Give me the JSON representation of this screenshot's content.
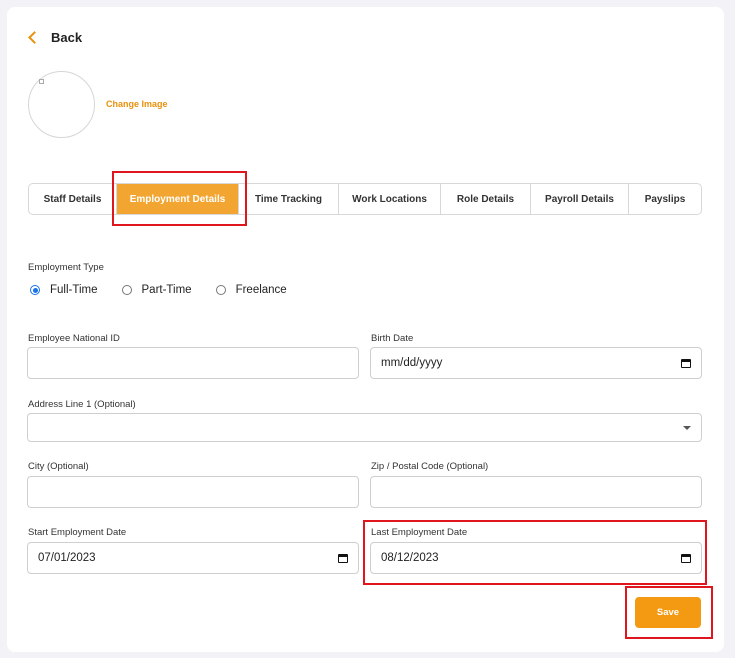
{
  "back_label": "Back",
  "change_image_label": "Change Image",
  "tabs": [
    {
      "label": "Staff Details"
    },
    {
      "label": "Employment Details"
    },
    {
      "label": "Time Tracking"
    },
    {
      "label": "Work Locations"
    },
    {
      "label": "Role Details"
    },
    {
      "label": "Payroll Details"
    },
    {
      "label": "Payslips"
    }
  ],
  "active_tab": "Employment Details",
  "employment_type": {
    "label": "Employment Type",
    "options": [
      "Full-Time",
      "Part-Time",
      "Freelance"
    ],
    "selected": "Full-Time"
  },
  "fields": {
    "national_id": {
      "label": "Employee National ID",
      "value": ""
    },
    "birth_date": {
      "label": "Birth Date",
      "value": "mm/dd/yyyy"
    },
    "address": {
      "label": "Address Line 1 (Optional)",
      "value": ""
    },
    "city": {
      "label": "City (Optional)",
      "value": ""
    },
    "zip": {
      "label": "Zip / Postal Code (Optional)",
      "value": ""
    },
    "start_date": {
      "label": "Start Employment Date",
      "value": "07/01/2023"
    },
    "last_date": {
      "label": "Last Employment Date",
      "value": "08/12/2023"
    }
  },
  "save_label": "Save",
  "colors": {
    "accent": "#f39a12",
    "highlight": "#e0161f",
    "radio": "#1a73e8"
  }
}
